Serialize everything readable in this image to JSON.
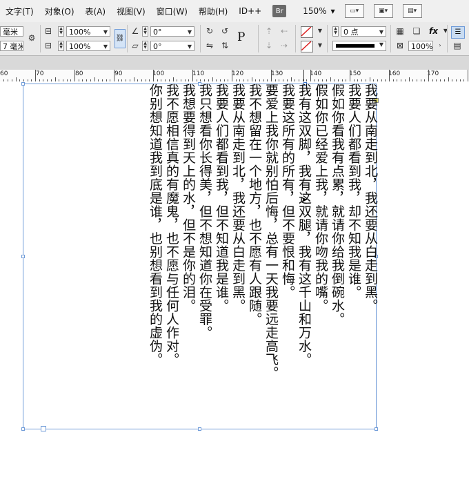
{
  "menubar": {
    "items": [
      "文字(T)",
      "对象(O)",
      "表(A)",
      "视图(V)",
      "窗口(W)",
      "帮助(H)",
      "ID++"
    ],
    "bridge_label": "Br",
    "zoom": "150%"
  },
  "controlbar": {
    "unit1": "毫米",
    "unit2": "7 毫米",
    "scale_x": "100%",
    "scale_y": "100%",
    "rotate": "0°",
    "shear": "0°",
    "stroke_weight": "0 点",
    "opacity": "100%",
    "p_label": "P",
    "fx_label": "fx"
  },
  "ruler": {
    "labels": [
      "60",
      "70",
      "80",
      "90",
      "100",
      "110",
      "120",
      "130",
      "140",
      "150",
      "160",
      "170"
    ]
  },
  "text_columns": [
    "我要从南走到北，我还要从白走到黑。",
    "我要人们都看到我，却不知我是谁。",
    "假如你看我有点累，就请你给我倒碗水。",
    "假如你已经爱上我，就请你吻我的嘴。",
    "我有这双脚，我有这双腿，我有这千山和万水。",
    "我要这所有的所有，但不要恨和悔。",
    "要爱上我你就别怕后悔，总有一天我要远走高飞。",
    "我不想留在一个地方，也不愿有人跟随。",
    "我要从南走到北，我还要从白走到黑。",
    "我要人们都看到我，但不知道我是谁。",
    "我只想看你长得美，但不想知道你在受罪。",
    "我想要得到天上的水，但不是你的泪。",
    "我不愿相信真的有魔鬼，也不愿与任何人作对。",
    "你别想知道我到底是谁，也别想看到我的虚伪。"
  ]
}
